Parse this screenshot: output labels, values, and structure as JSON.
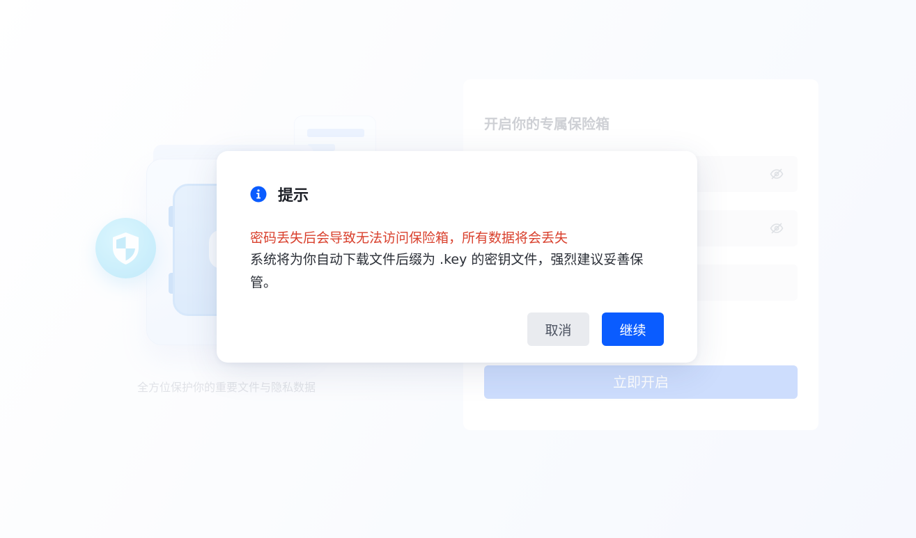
{
  "background": {
    "caption": "全方位保护你的重要文件与隐私数据",
    "card": {
      "title": "开启你的专属保险箱",
      "fields": [
        {
          "icon": "eye-off-icon"
        },
        {
          "icon": "eye-off-icon"
        },
        {}
      ],
      "submit_label": "立即开启",
      "submit_color": "#a5c2fb"
    }
  },
  "dialog": {
    "icon": "info-icon",
    "icon_color": "#0a5cff",
    "title": "提示",
    "warning": "密码丢失后会导致无法访问保险箱，所有数据将会丢失",
    "warning_color": "#d9412e",
    "description": "系统将为你自动下载文件后缀为 .key 的密钥文件，强烈建议妥善保管。",
    "cancel_label": "取消",
    "confirm_label": "继续",
    "confirm_color": "#0a5cff"
  }
}
